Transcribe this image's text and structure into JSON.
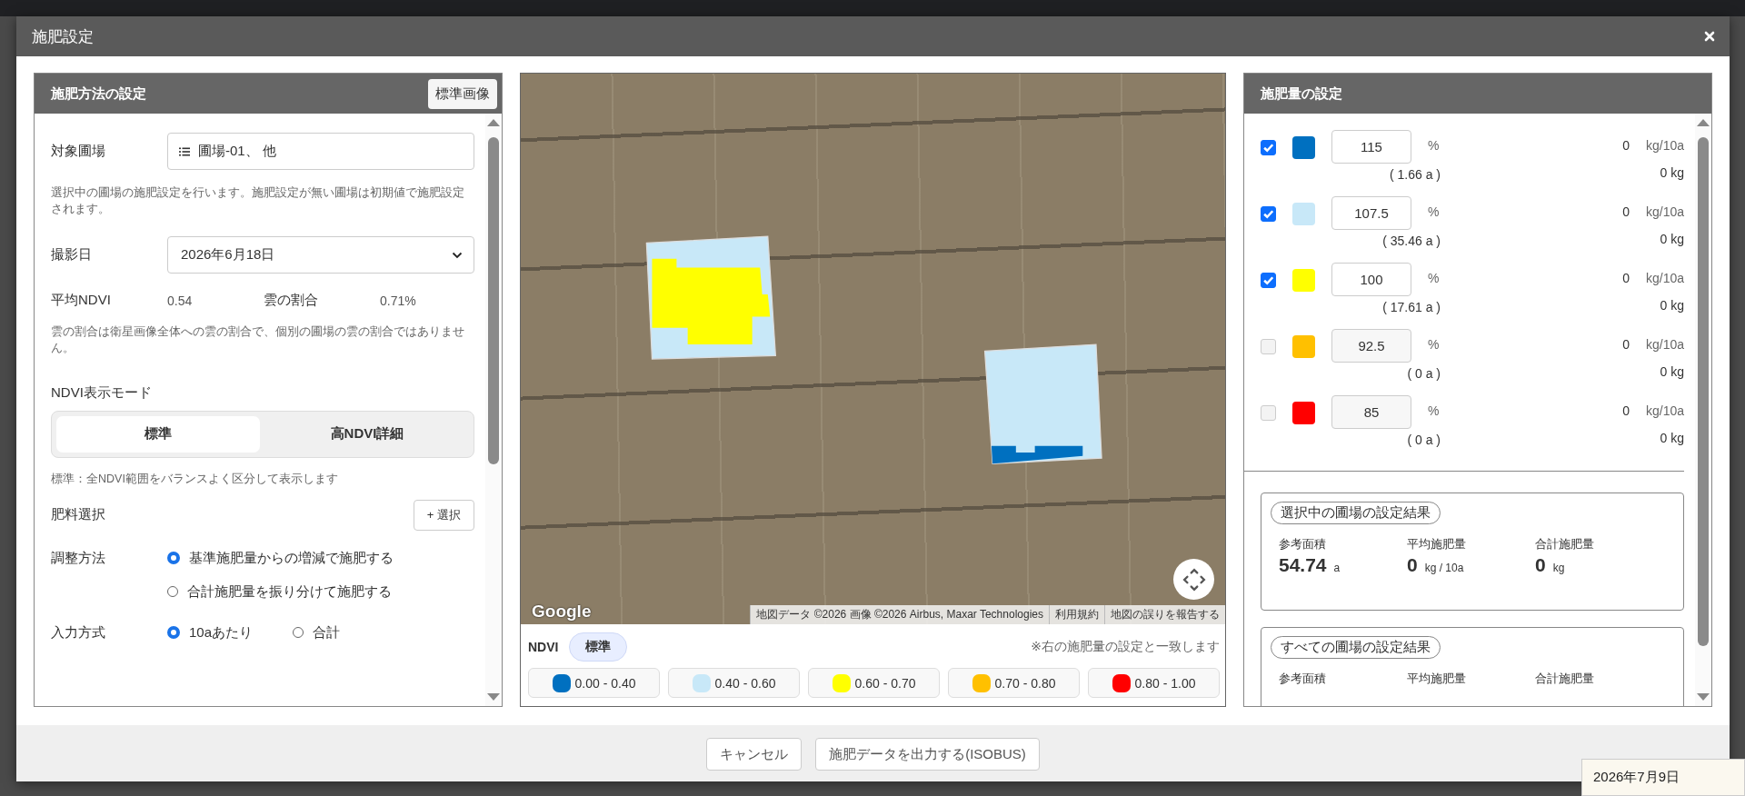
{
  "dialog": {
    "title": "施肥設定"
  },
  "method_panel": {
    "title": "施肥方法の設定",
    "image_button": "標準画像",
    "target_field": {
      "label": "対象圃場",
      "value": "圃場-01、 他"
    },
    "target_note": "選択中の圃場の施肥設定を行います。施肥設定が無い圃場は初期値で施肥設定されます。",
    "capture_date": {
      "label": "撮影日",
      "value": "2026年6月18日"
    },
    "avg_ndvi": {
      "label": "平均NDVI",
      "value": "0.54"
    },
    "cloud_ratio": {
      "label": "雲の割合",
      "value": "0.71%"
    },
    "cloud_note": "雲の割合は衛星画像全体への雲の割合で、個別の圃場の雲の割合ではありません。",
    "ndvi_mode": {
      "label": "NDVI表示モード",
      "options": [
        {
          "label": "標準",
          "selected": true
        },
        {
          "label": "高NDVI詳細",
          "selected": false
        }
      ],
      "description": "標準：全NDVI範囲をバランスよく区分して表示します"
    },
    "fertilizer": {
      "label": "肥料選択",
      "button": "+ 選択"
    },
    "adjust_method": {
      "label": "調整方法",
      "options": [
        {
          "label": "基準施肥量からの増減で施肥する",
          "selected": true
        },
        {
          "label": "合計施肥量を振り分けて施肥する",
          "selected": false
        }
      ]
    },
    "input_mode": {
      "label": "入力方式",
      "options": [
        {
          "label": "10aあたり",
          "selected": true
        },
        {
          "label": "合計",
          "selected": false
        }
      ]
    }
  },
  "map": {
    "logo": "Google",
    "attribution": [
      "地図データ ©2026 画像 ©2026 Airbus, Maxar Technologies",
      "利用規約",
      "地図の誤りを報告する"
    ]
  },
  "legend": {
    "label": "NDVI",
    "mode": "標準",
    "note": "※右の施肥量の設定と一致します",
    "items": [
      {
        "range": "0.00 - 0.40",
        "color": "#0070c0"
      },
      {
        "range": "0.40 - 0.60",
        "color": "#c8e8f8"
      },
      {
        "range": "0.60 - 0.70",
        "color": "#ffff00"
      },
      {
        "range": "0.70 - 0.80",
        "color": "#ffc000"
      },
      {
        "range": "0.80 - 1.00",
        "color": "#ff0000"
      }
    ]
  },
  "rate_panel": {
    "title": "施肥量の設定",
    "rows": [
      {
        "checked": true,
        "color": "#0070c0",
        "percent": "115",
        "percent_unit": "%",
        "area": "( 1.66 a )",
        "rate": "0",
        "rate_unit": "kg/10a",
        "total": "0 kg"
      },
      {
        "checked": true,
        "color": "#c8e8f8",
        "percent": "107.5",
        "percent_unit": "%",
        "area": "( 35.46 a )",
        "rate": "0",
        "rate_unit": "kg/10a",
        "total": "0 kg"
      },
      {
        "checked": true,
        "color": "#ffff00",
        "percent": "100",
        "percent_unit": "%",
        "area": "( 17.61 a )",
        "rate": "0",
        "rate_unit": "kg/10a",
        "total": "0 kg"
      },
      {
        "checked": false,
        "color": "#ffc000",
        "percent": "92.5",
        "percent_unit": "%",
        "area": "( 0 a )",
        "rate": "0",
        "rate_unit": "kg/10a",
        "total": "0 kg"
      },
      {
        "checked": false,
        "color": "#ff0000",
        "percent": "85",
        "percent_unit": "%",
        "area": "( 0 a )",
        "rate": "0",
        "rate_unit": "kg/10a",
        "total": "0 kg"
      }
    ],
    "results": [
      {
        "title": "選択中の圃場の設定結果",
        "metrics": [
          {
            "label": "参考面積",
            "value": "54.74",
            "unit": "a"
          },
          {
            "label": "平均施肥量",
            "value": "0",
            "unit": "kg / 10a"
          },
          {
            "label": "合計施肥量",
            "value": "0",
            "unit": "kg"
          }
        ]
      },
      {
        "title": "すべての圃場の設定結果",
        "metrics": [
          {
            "label": "参考面積"
          },
          {
            "label": "平均施肥量"
          },
          {
            "label": "合計施肥量"
          }
        ]
      }
    ]
  },
  "footer": {
    "buttons": [
      "キャンセル",
      "施肥データを出力する(ISOBUS)"
    ]
  },
  "date_tooltip": "2026年7月9日"
}
